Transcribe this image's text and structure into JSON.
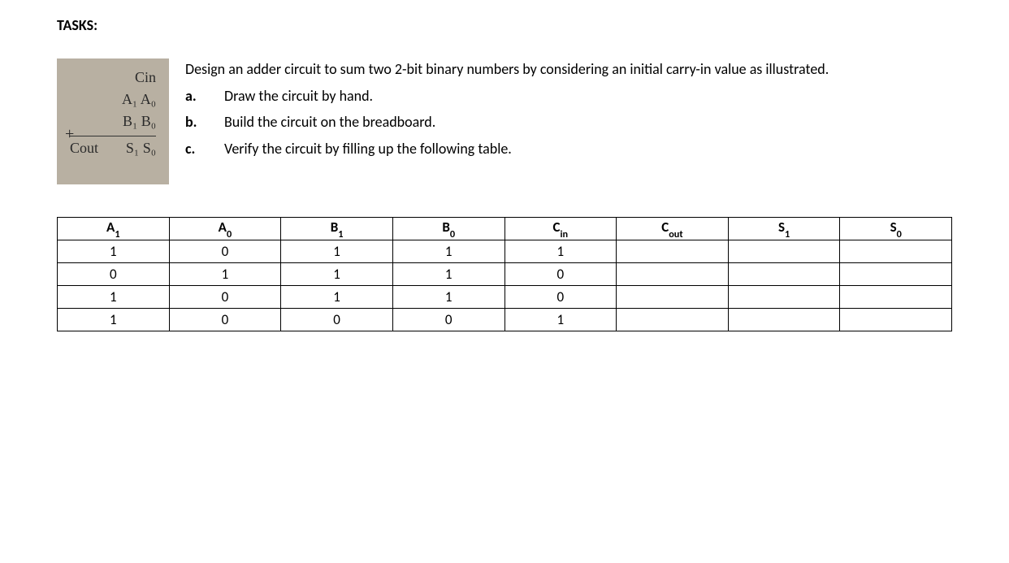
{
  "heading": "TASKS:",
  "sketch": {
    "cin": "Cin",
    "row_a": "A₁  A₀",
    "row_b": "B₁  B₀",
    "plus": "+",
    "cout": "Cout",
    "result": "S₁  S₀"
  },
  "problem": {
    "intro": "Design an adder circuit to sum two 2-bit binary numbers by considering an initial carry-in value as illustrated.",
    "items": [
      {
        "letter": "a.",
        "text": "Draw the circuit by hand."
      },
      {
        "letter": "b.",
        "text": "Build the circuit on the breadboard."
      },
      {
        "letter": "c.",
        "text": "Verify the circuit by filling up the following table."
      }
    ]
  },
  "table": {
    "headers": {
      "a1": {
        "main": "A",
        "sub": "1"
      },
      "a0": {
        "main": "A",
        "sub": "0"
      },
      "b1": {
        "main": "B",
        "sub": "1"
      },
      "b0": {
        "main": "B",
        "sub": "0"
      },
      "cin": {
        "main": "C",
        "sub": "in"
      },
      "cout": {
        "main": "C",
        "sub": "out"
      },
      "s1": {
        "main": "S",
        "sub": "1"
      },
      "s0": {
        "main": "S",
        "sub": "0"
      }
    },
    "rows": [
      {
        "a1": "1",
        "a0": "0",
        "b1": "1",
        "b0": "1",
        "cin": "1",
        "cout": "",
        "s1": "",
        "s0": ""
      },
      {
        "a1": "0",
        "a0": "1",
        "b1": "1",
        "b0": "1",
        "cin": "0",
        "cout": "",
        "s1": "",
        "s0": ""
      },
      {
        "a1": "1",
        "a0": "0",
        "b1": "1",
        "b0": "1",
        "cin": "0",
        "cout": "",
        "s1": "",
        "s0": ""
      },
      {
        "a1": "1",
        "a0": "0",
        "b1": "0",
        "b0": "0",
        "cin": "1",
        "cout": "",
        "s1": "",
        "s0": ""
      }
    ]
  }
}
